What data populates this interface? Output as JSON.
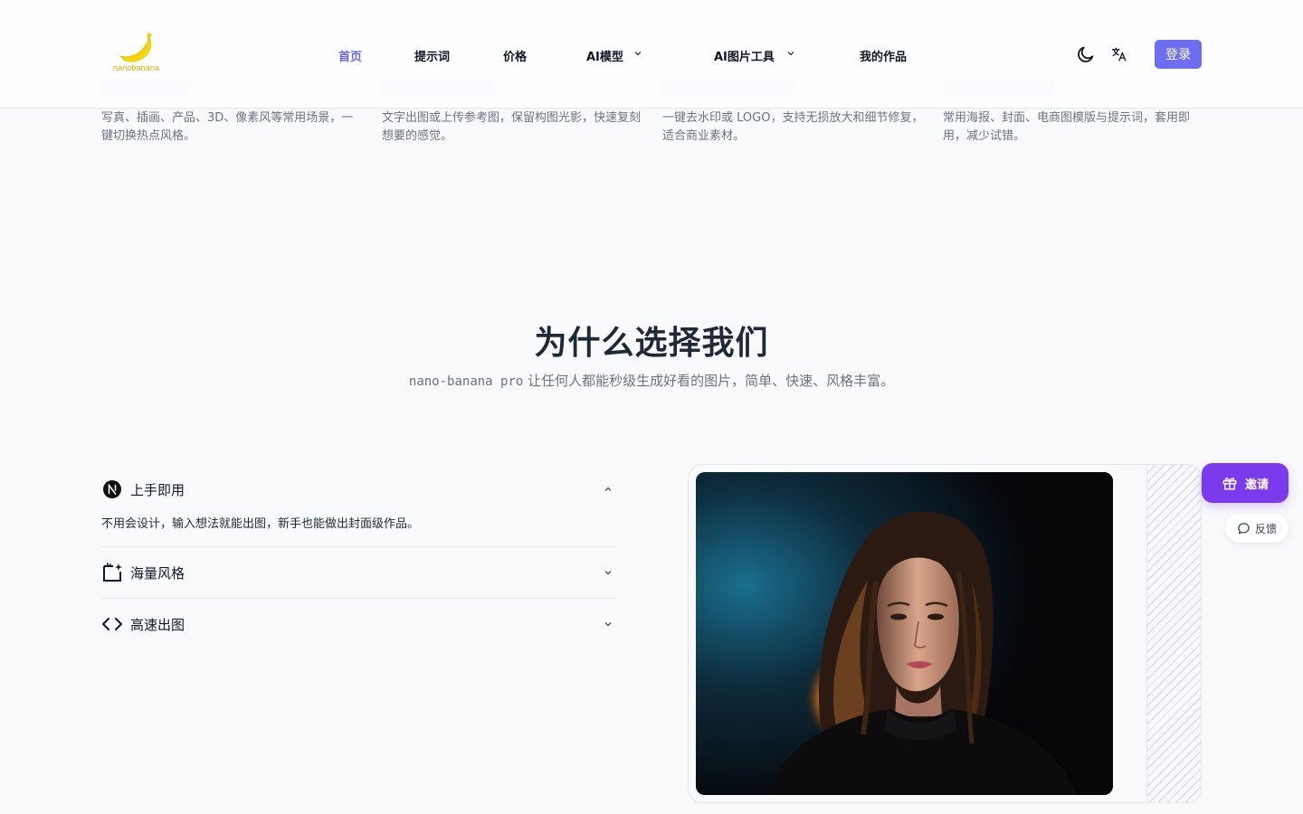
{
  "header": {
    "logo_text": "nanobanana",
    "nav": [
      {
        "label": "首页",
        "active": true,
        "dropdown": false
      },
      {
        "label": "提示词",
        "active": false,
        "dropdown": false
      },
      {
        "label": "价格",
        "active": false,
        "dropdown": false
      },
      {
        "label": "AI模型",
        "active": false,
        "dropdown": true
      },
      {
        "label": "AI图片工具",
        "active": false,
        "dropdown": true
      },
      {
        "label": "我的作品",
        "active": false,
        "dropdown": false
      }
    ],
    "theme_icon": "moon-icon",
    "language_icon": "translate-icon",
    "login_label": "登录",
    "accent_color": "#6d6ef0"
  },
  "features": [
    {
      "desc": "写真、插画、产品、3D、像素风等常用场景，一键切换热点风格。"
    },
    {
      "desc": "文字出图或上传参考图，保留构图光影，快速复刻想要的感觉。"
    },
    {
      "desc": "一键去水印或 LOGO，支持无损放大和细节修复，适合商业素材。"
    },
    {
      "desc": "常用海报、封面、电商图模版与提示词，套用即用，减少试错。"
    }
  ],
  "why": {
    "title": "为什么选择我们",
    "subtitle_brand": "nano-banana pro",
    "subtitle_rest": " 让任何人都能秒级生成好看的图片，简单、快速、风格丰富。"
  },
  "accordion": [
    {
      "label": "上手即用",
      "icon": "nextjs-logo-icon",
      "open": true,
      "body": "不用会设计，输入想法就能出图，新手也能做出封面级作品。"
    },
    {
      "label": "海量风格",
      "icon": "sparkle-frame-icon",
      "open": false
    },
    {
      "label": "高速出图",
      "icon": "code-brackets-icon",
      "open": false
    }
  ],
  "floating": {
    "invite_label": "邀请",
    "invite_color": "#7c3aed",
    "feedback_label": "反馈"
  }
}
